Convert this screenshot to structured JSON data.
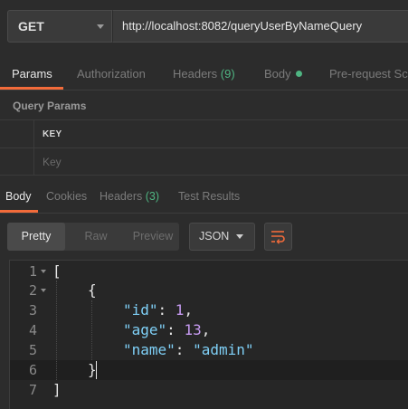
{
  "request": {
    "method": "GET",
    "url": "http://localhost:8082/queryUserByNameQuery"
  },
  "request_tabs": [
    {
      "label": "Params",
      "active": true
    },
    {
      "label": "Authorization"
    },
    {
      "label": "Headers",
      "count": "(9)"
    },
    {
      "label": "Body",
      "dot": true
    },
    {
      "label": "Pre-request Scri"
    }
  ],
  "query_params": {
    "title": "Query Params",
    "column_key": "KEY",
    "key_placeholder": "Key"
  },
  "response_tabs": [
    {
      "label": "Body",
      "active": true
    },
    {
      "label": "Cookies"
    },
    {
      "label": "Headers",
      "count": "(3)"
    },
    {
      "label": "Test Results"
    }
  ],
  "view": {
    "modes": [
      "Pretty",
      "Raw",
      "Preview"
    ],
    "active_mode": "Pretty",
    "format": "JSON",
    "wrap_icon": "wrap-lines-icon"
  },
  "response_body": {
    "line_numbers": [
      "1",
      "2",
      "3",
      "4",
      "5",
      "6",
      "7"
    ],
    "lines": {
      "l1": "[",
      "l2": "{",
      "id_key": "\"id\"",
      "id_val": "1",
      "age_key": "\"age\"",
      "age_val": "13",
      "name_key": "\"name\"",
      "name_val": "\"admin\"",
      "l6": "}",
      "l7": "]"
    }
  },
  "colors": {
    "accent": "#f26b3a",
    "count_green": "#4fb582",
    "json_key": "#7fd0f7",
    "json_number": "#c79bf2"
  }
}
